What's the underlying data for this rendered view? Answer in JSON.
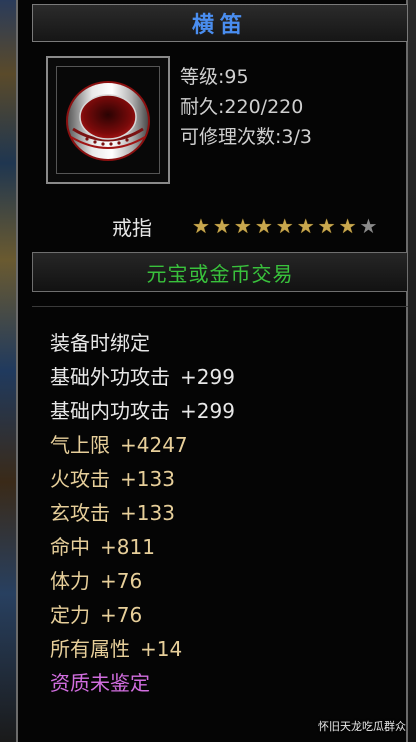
{
  "item": {
    "name": "横笛",
    "level_label": "等级:95",
    "durability_label": "耐久:220/220",
    "repair_label": "可修理次数:3/3",
    "type": "戒指",
    "stars_total": 9,
    "stars_filled": 8,
    "trade": "元宝或金币交易"
  },
  "attributes": [
    {
      "label": "装备时绑定",
      "value": "",
      "color": "#e8e8e8"
    },
    {
      "label": "基础外功攻击",
      "value": "+299",
      "color": "#e8e8e8"
    },
    {
      "label": "基础内功攻击",
      "value": "+299",
      "color": "#e8e8e8"
    },
    {
      "label": "气上限",
      "value": "+4247",
      "color": "#e7cf9a"
    },
    {
      "label": "火攻击",
      "value": "+133",
      "color": "#e7cf9a"
    },
    {
      "label": "玄攻击",
      "value": "+133",
      "color": "#e7cf9a"
    },
    {
      "label": "命中",
      "value": "+811",
      "color": "#e7cf9a"
    },
    {
      "label": "体力",
      "value": "+76",
      "color": "#e7cf9a"
    },
    {
      "label": "定力",
      "value": "+76",
      "color": "#e7cf9a"
    },
    {
      "label": "所有属性",
      "value": "+14",
      "color": "#e7cf9a"
    },
    {
      "label": "资质未鉴定",
      "value": "",
      "color": "#d26ee0"
    }
  ],
  "watermark": "怀旧天龙吃瓜群众",
  "colors": {
    "title": "#4a8ef0",
    "trade": "#39c23c",
    "star_on": "#c9a84e",
    "star_off": "#8a8a8a"
  }
}
